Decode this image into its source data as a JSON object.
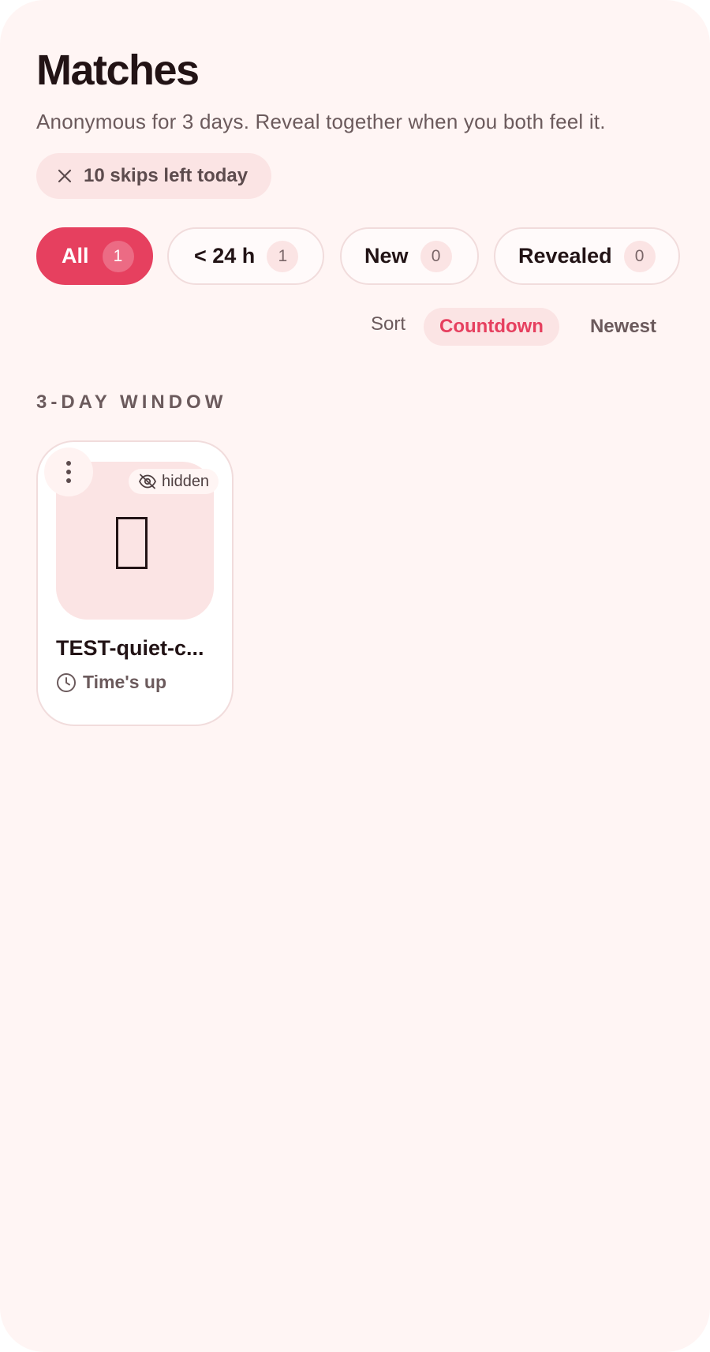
{
  "header": {
    "title": "Matches",
    "subtitle": "Anonymous for 3 days. Reveal together when you both feel it."
  },
  "skips": {
    "label": "10 skips left today",
    "icon": "close-icon"
  },
  "filters": [
    {
      "label": "All",
      "count": "1",
      "active": true
    },
    {
      "label": "< 24 h",
      "count": "1",
      "active": false
    },
    {
      "label": "New",
      "count": "0",
      "active": false
    },
    {
      "label": "Revealed",
      "count": "0",
      "active": false
    }
  ],
  "sort": {
    "label": "Sort",
    "options": [
      {
        "label": "Countdown",
        "active": true
      },
      {
        "label": "Newest",
        "active": false
      }
    ]
  },
  "section": {
    "title": "3-DAY WINDOW"
  },
  "matches": [
    {
      "name": "TEST-quiet-c...",
      "badge": "hidden",
      "status": "Time's up",
      "avatar_glyph": "missing-glyph"
    }
  ],
  "colors": {
    "accent": "#e6405f",
    "background": "#fff5f4",
    "chip": "#fbe4e4",
    "text": "#221315",
    "muted": "#6b5a5c"
  }
}
